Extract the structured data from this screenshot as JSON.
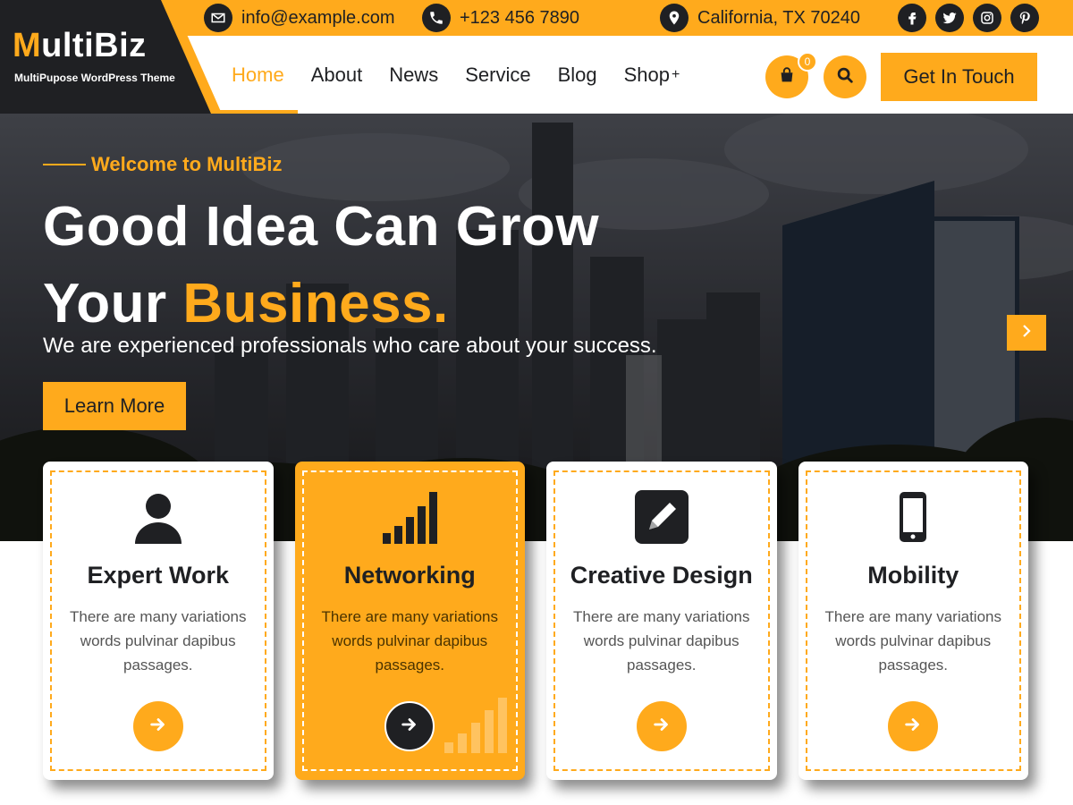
{
  "brand": {
    "first_letter": "M",
    "rest": "ultiBiz",
    "tagline": "MultiPupose WordPress Theme"
  },
  "topbar": {
    "email": "info@example.com",
    "phone": "+123 456 7890",
    "location": "California, TX 70240",
    "socials": [
      "facebook-icon",
      "twitter-icon",
      "instagram-icon",
      "pinterest-icon"
    ]
  },
  "nav": {
    "items": [
      {
        "label": "Home",
        "active": true
      },
      {
        "label": "About"
      },
      {
        "label": "News"
      },
      {
        "label": "Service"
      },
      {
        "label": "Blog"
      },
      {
        "label": "Shop",
        "has_submenu": true
      }
    ],
    "submenu_indicator": "+",
    "cart_count": "0",
    "cta_label": "Get In Touch"
  },
  "hero": {
    "eyebrow": "Welcome to MultiBiz",
    "title_line1": "Good Idea Can Grow",
    "title_line2_prefix": "Your ",
    "title_line2_accent": "Business.",
    "subtitle": "We are experienced professionals who care about your success.",
    "button_label": "Learn More"
  },
  "cards": [
    {
      "icon": "user-icon",
      "title": "Expert Work",
      "text": "There are many variations words pulvinar dapibus passages.",
      "highlight": false
    },
    {
      "icon": "signal-bars-icon",
      "title": "Networking",
      "text": "There are many variations words pulvinar dapibus passages.",
      "highlight": true
    },
    {
      "icon": "pencil-square-icon",
      "title": "Creative Design",
      "text": "There are many variations words pulvinar dapibus passages.",
      "highlight": false
    },
    {
      "icon": "mobile-phone-icon",
      "title": "Mobility",
      "text": "There are many variations words pulvinar dapibus passages.",
      "highlight": false
    }
  ],
  "colors": {
    "accent": "#ffaa1c",
    "dark": "#1f2023",
    "white": "#ffffff"
  }
}
